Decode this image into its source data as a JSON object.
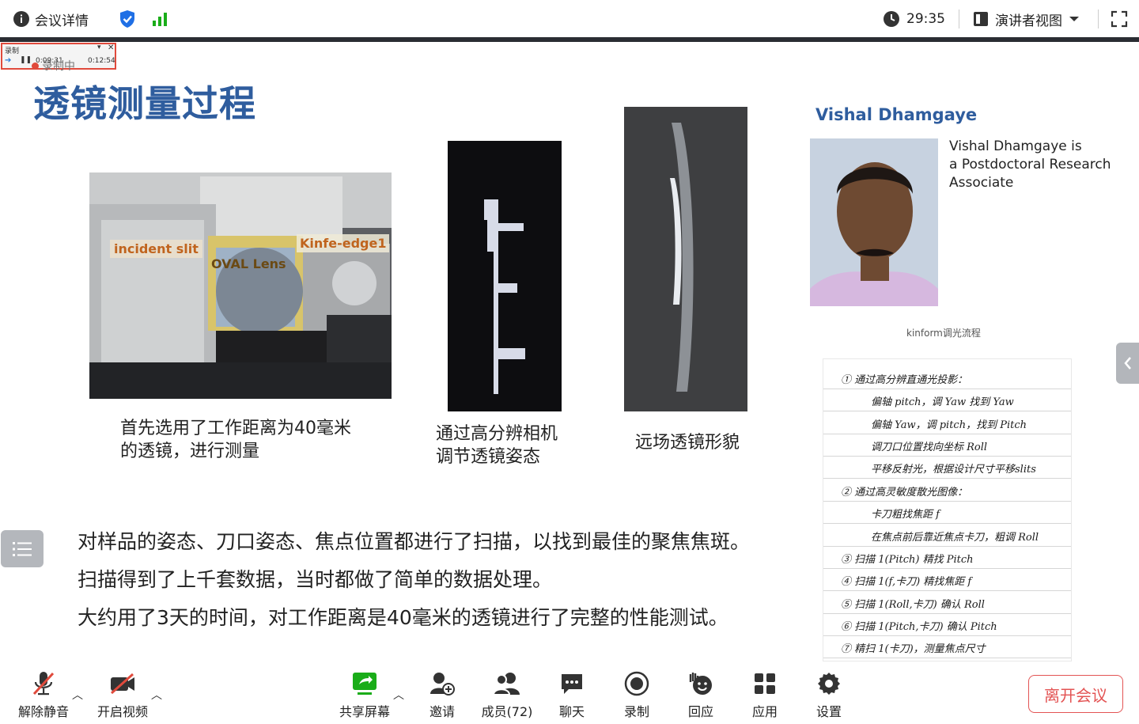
{
  "topbar": {
    "meeting_info_label": "会议详情",
    "timer": "29:35",
    "view_mode_label": "演讲者视图"
  },
  "recorder": {
    "title": "录制",
    "elapsed": "0:09:31",
    "total": "0:12:54",
    "status_label": "录制中"
  },
  "slide": {
    "title": "透镜测量过程",
    "photo1": {
      "label_slit": "incident slit",
      "label_lens": "OVAL Lens",
      "label_knife": "Kinfe-edge1",
      "caption_line1": "首先选用了工作距离为40毫米",
      "caption_line2": "的透镜，进行测量"
    },
    "photo2": {
      "caption_line1": "通过高分辨相机",
      "caption_line2": "调节透镜姿态"
    },
    "photo3": {
      "caption": "远场透镜形貌"
    },
    "profile": {
      "name": "Vishal Dhamgaye",
      "desc_line1": "Vishal Dhamgaye is",
      "desc_line2": "a Postdoctoral Research",
      "desc_line3": "Associate"
    },
    "notes_title": "kinform调光流程",
    "body_line1": "对样品的姿态、刀口姿态、焦点位置都进行了扫描，以找到最佳的聚焦焦斑。",
    "body_line2": "扫描得到了上千套数据，当时都做了简单的数据处理。",
    "body_line3": "大约用了3天的时间，对工作距离是40毫米的透镜进行了完整的性能测试。"
  },
  "handwritten_notes": [
    "① 通过高分辨直通光投影：",
    "偏轴 pitch，调 Yaw 找到 Yaw",
    "偏轴 Yaw，调 pitch，找到 Pitch",
    "调刀口位置找向坐标 Roll",
    "平移反射光，根据设计尺寸平移slits",
    "② 通过高灵敏度散光图像：",
    "卡刀粗找焦距 f",
    "在焦点前后靠近焦点卡刀，粗调 Roll",
    "③ 扫描 1(Pitch) 精找 Pitch",
    "④ 扫描 1(f,卡刀) 精找焦距 f",
    "⑤ 扫描 1(Roll,卡刀) 确认 Roll",
    "⑥ 扫描 1(Pitch,卡刀) 确认 Pitch",
    "⑦ 精扫 1(卡刀)，测量焦点尺寸"
  ],
  "toolbar": {
    "unmute": "解除静音",
    "start_video": "开启视频",
    "share_screen": "共享屏幕",
    "invite": "邀请",
    "members": "成员(72)",
    "chat": "聊天",
    "record": "录制",
    "reaction": "回应",
    "apps": "应用",
    "settings": "设置",
    "leave": "离开会议"
  },
  "colors": {
    "title_blue": "#2f5d9e",
    "accent_green": "#1aad19",
    "shield_blue": "#1f6fe5",
    "leave_red": "#e35454",
    "record_red": "#e04a3c"
  }
}
